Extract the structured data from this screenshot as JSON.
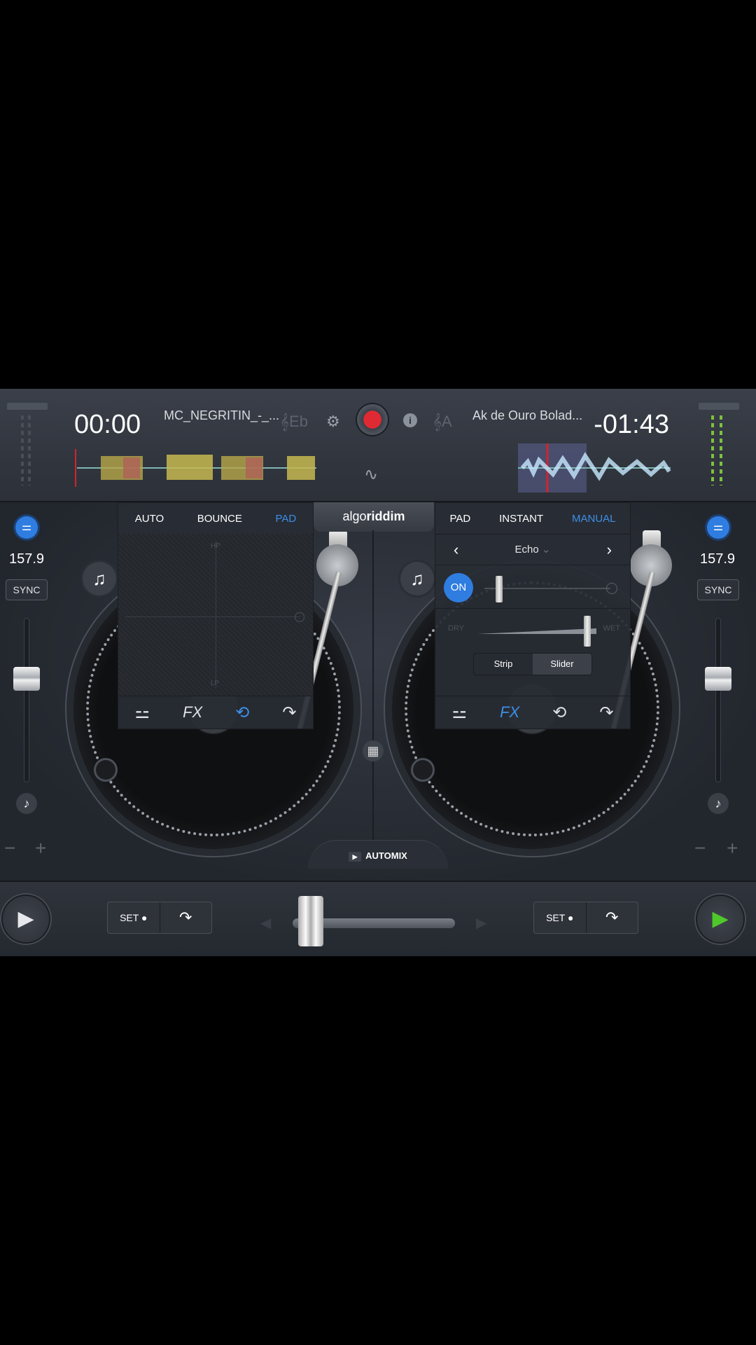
{
  "deck_left": {
    "elapsed": "00:00",
    "title": "MC_NEGRITIN_-_...",
    "key": "Eb",
    "bpm": "157.9",
    "sync_label": "SYNC",
    "set_label": "SET",
    "panel": {
      "tabs": [
        "AUTO",
        "BOUNCE",
        "PAD"
      ],
      "active_tab": "PAD",
      "xy_top": "HP",
      "xy_bottom": "LP"
    },
    "bottom_icons": [
      "mixer-icon",
      "fx-icon",
      "loop-icon",
      "cue-jump-icon"
    ],
    "fx_label": "FX"
  },
  "deck_right": {
    "remaining": "-01:43",
    "title": "Ak de Ouro Bolad...",
    "key": "A",
    "bpm": "157.9",
    "sync_label": "SYNC",
    "set_label": "SET",
    "panel": {
      "tabs": [
        "PAD",
        "INSTANT",
        "MANUAL"
      ],
      "active_tab": "MANUAL",
      "effect_name": "Echo",
      "on_label": "ON",
      "dry_label": "DRY",
      "wet_label": "WET",
      "mode_strip": "Strip",
      "mode_slider": "Slider",
      "active_mode": "Slider"
    },
    "fx_label": "FX"
  },
  "center": {
    "logo_light": "algo",
    "logo_bold": "riddim",
    "automix_label": "AUTOMIX"
  },
  "pitch": {
    "left_level": 0.35,
    "right_level": 0.35
  },
  "crossfader_level": 0.05,
  "colors": {
    "accent": "#3d8fe8",
    "record": "#e02a33",
    "play_active": "#4fc92a",
    "meter": "#7dc13e"
  }
}
